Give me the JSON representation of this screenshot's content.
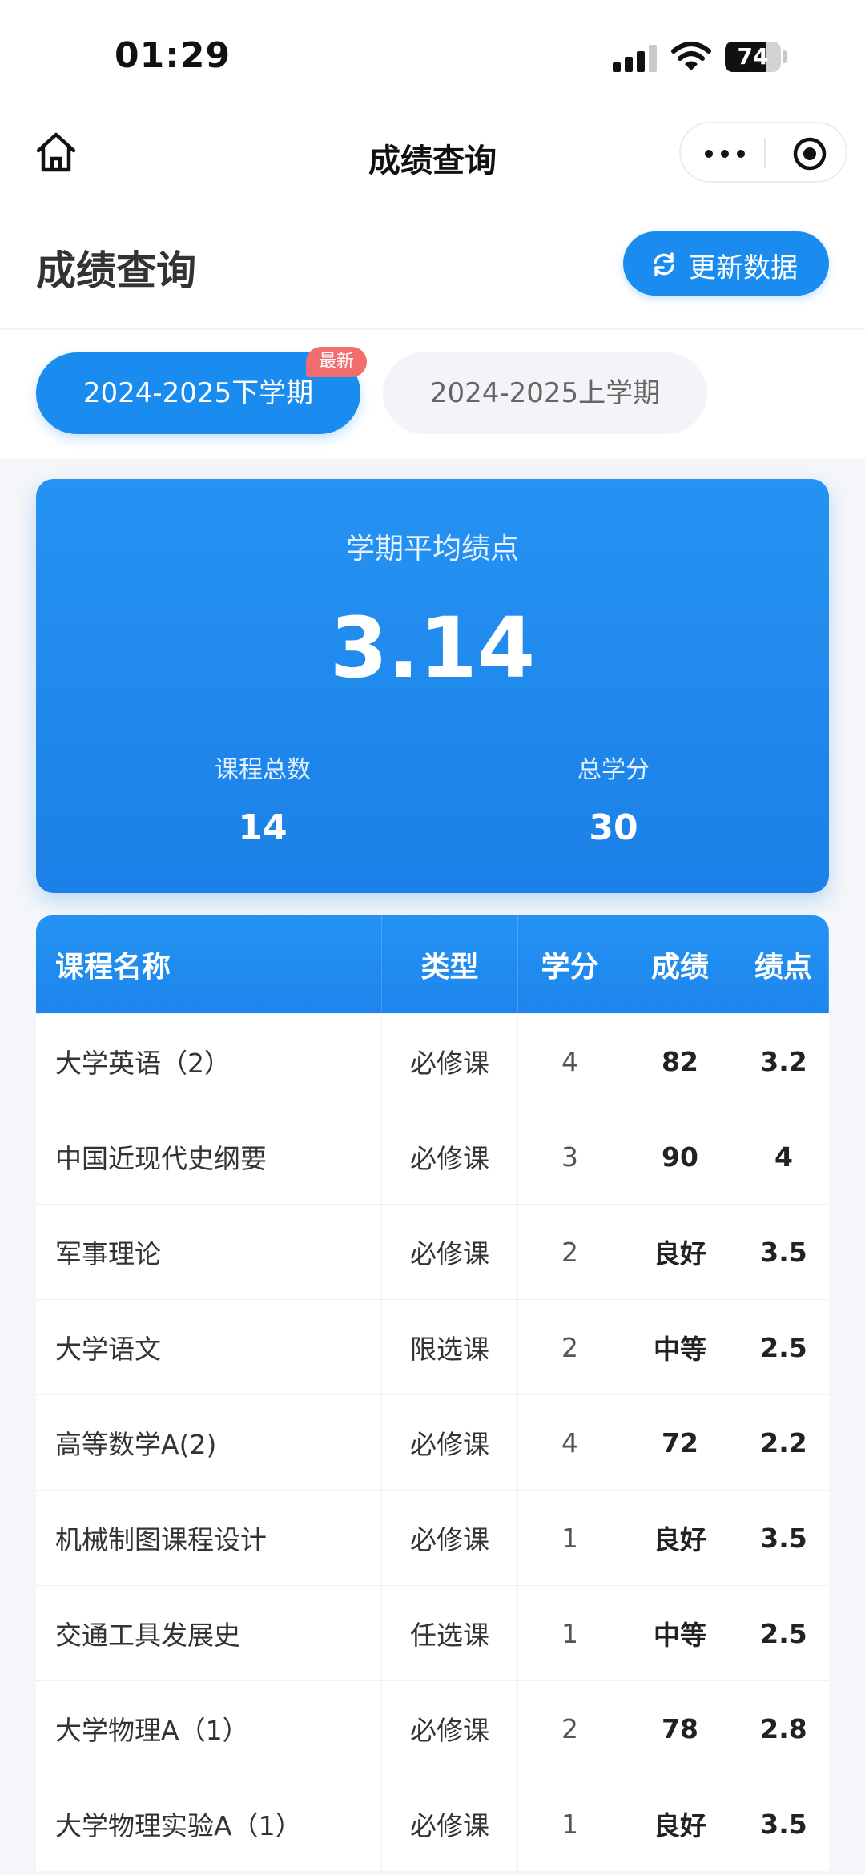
{
  "status_bar": {
    "time": "01:29",
    "battery": "74",
    "battery_level": 0.74
  },
  "nav": {
    "title": "成绩查询",
    "home_icon": "home-icon",
    "more_icon": "more-icon",
    "target_icon": "target-icon"
  },
  "header": {
    "title": "成绩查询",
    "refresh_label": "更新数据",
    "refresh_icon": "refresh-icon"
  },
  "tabs": [
    {
      "label": "2024-2025下学期",
      "active": true,
      "badge": "最新"
    },
    {
      "label": "2024-2025上学期",
      "active": false
    }
  ],
  "summary": {
    "gpa_label": "学期平均绩点",
    "gpa_value": "3.14",
    "course_count_label": "课程总数",
    "course_count": "14",
    "total_credits_label": "总学分",
    "total_credits": "30"
  },
  "table": {
    "headers": [
      "课程名称",
      "类型",
      "学分",
      "成绩",
      "绩点"
    ],
    "rows": [
      [
        "大学英语（2）",
        "必修课",
        "4",
        "82",
        "3.2"
      ],
      [
        "中国近现代史纲要",
        "必修课",
        "3",
        "90",
        "4"
      ],
      [
        "军事理论",
        "必修课",
        "2",
        "良好",
        "3.5"
      ],
      [
        "大学语文",
        "限选课",
        "2",
        "中等",
        "2.5"
      ],
      [
        "高等数学A(2)",
        "必修课",
        "4",
        "72",
        "2.2"
      ],
      [
        "机械制图课程设计",
        "必修课",
        "1",
        "良好",
        "3.5"
      ],
      [
        "交通工具发展史",
        "任选课",
        "1",
        "中等",
        "2.5"
      ],
      [
        "大学物理A（1）",
        "必修课",
        "2",
        "78",
        "2.8"
      ],
      [
        "大学物理实验A（1）",
        "必修课",
        "1",
        "良好",
        "3.5"
      ]
    ]
  },
  "colors": {
    "primary": "#1a8cf0",
    "badge": "#f26d6d",
    "background": "#f4f6f9"
  }
}
